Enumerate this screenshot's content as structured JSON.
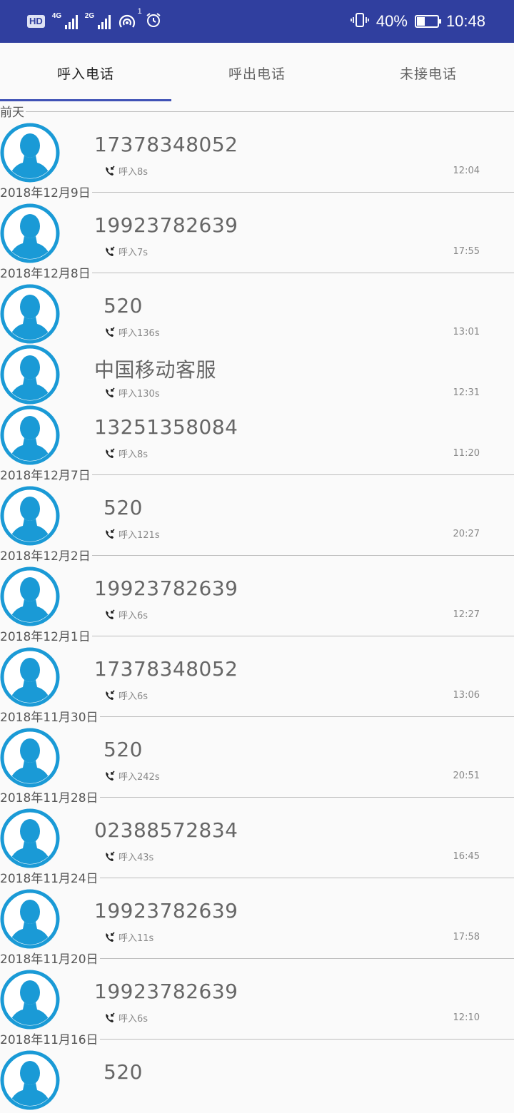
{
  "status_bar": {
    "hd": "HD",
    "net1": "4G",
    "net2": "2G",
    "hotspot_count": "1",
    "battery_percent": "40%",
    "battery_level": 0.4,
    "time": "10:48"
  },
  "tabs": [
    {
      "label": "呼入电话",
      "active": true
    },
    {
      "label": "呼出电话",
      "active": false
    },
    {
      "label": "未接电话",
      "active": false
    }
  ],
  "groups": [
    {
      "date": "前天",
      "items": [
        {
          "number": "17378348052",
          "type": "呼入8s",
          "time": "12:04"
        }
      ]
    },
    {
      "date": "2018年12月9日",
      "items": [
        {
          "number": "19923782639",
          "type": "呼入7s",
          "time": "17:55"
        }
      ]
    },
    {
      "date": "2018年12月8日",
      "items": [
        {
          "number": "520",
          "type": "呼入136s",
          "time": "13:01"
        },
        {
          "number": "中国移动客服",
          "type": "呼入130s",
          "time": "12:31"
        },
        {
          "number": "13251358084",
          "type": "呼入8s",
          "time": "11:20"
        }
      ]
    },
    {
      "date": "2018年12月7日",
      "items": [
        {
          "number": "520",
          "type": "呼入121s",
          "time": "20:27"
        }
      ]
    },
    {
      "date": "2018年12月2日",
      "items": [
        {
          "number": "19923782639",
          "type": "呼入6s",
          "time": "12:27"
        }
      ]
    },
    {
      "date": "2018年12月1日",
      "items": [
        {
          "number": "17378348052",
          "type": "呼入6s",
          "time": "13:06"
        }
      ]
    },
    {
      "date": "2018年11月30日",
      "items": [
        {
          "number": "520",
          "type": "呼入242s",
          "time": "20:51"
        }
      ]
    },
    {
      "date": "2018年11月28日",
      "items": [
        {
          "number": "02388572834",
          "type": "呼入43s",
          "time": "16:45"
        }
      ]
    },
    {
      "date": "2018年11月24日",
      "items": [
        {
          "number": "19923782639",
          "type": "呼入11s",
          "time": "17:58"
        }
      ]
    },
    {
      "date": "2018年11月20日",
      "items": [
        {
          "number": "19923782639",
          "type": "呼入6s",
          "time": "12:10"
        }
      ]
    },
    {
      "date": "2018年11月16日",
      "items": [
        {
          "number": "520",
          "type": "",
          "time": ""
        }
      ]
    }
  ],
  "colors": {
    "status_bar": "#303f9f",
    "tab_indicator": "#3f51b5",
    "avatar": "#1a9ad6"
  }
}
